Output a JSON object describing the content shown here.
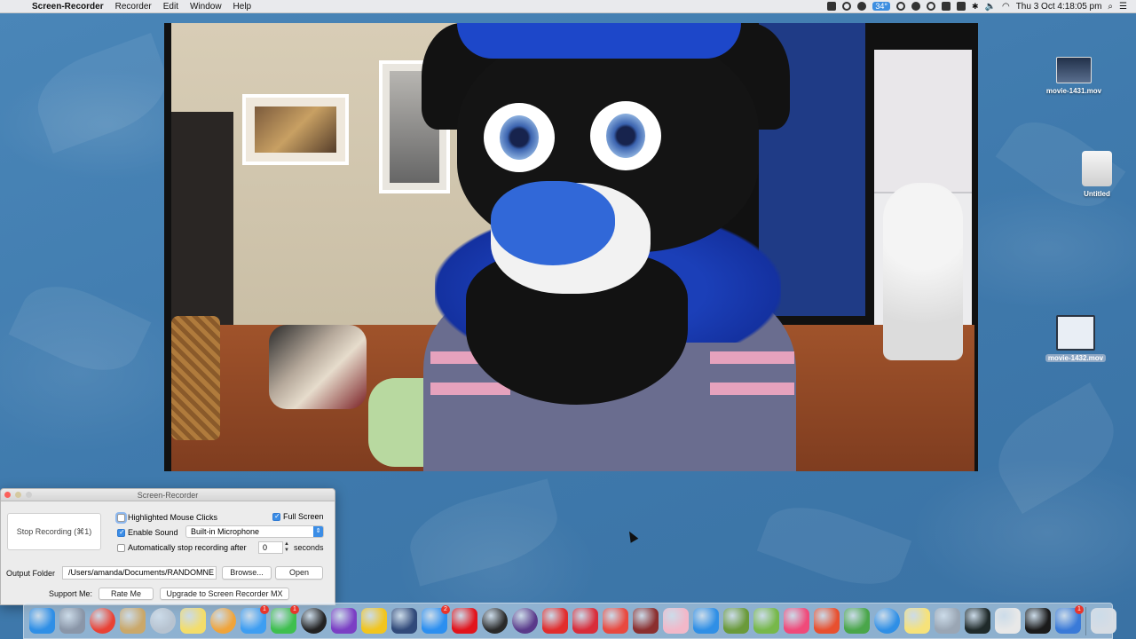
{
  "menubar": {
    "app_name": "Screen-Recorder",
    "menus": [
      "Recorder",
      "Edit",
      "Window",
      "Help"
    ],
    "temperature": "34°",
    "datetime": "Thu 3 Oct  4:18:05 pm"
  },
  "desktop_icons": [
    {
      "label": "movie-1431.mov",
      "icon": "video-file-icon"
    },
    {
      "label": "Untitled",
      "icon": "disk-drive-icon"
    },
    {
      "label": "movie-1432.mov",
      "icon": "video-file-icon",
      "selected": true
    }
  ],
  "recorder": {
    "title": "Screen-Recorder",
    "stop_button": "Stop Recording (⌘1)",
    "highlight_clicks": {
      "label": "Highlighted Mouse Clicks",
      "checked": false
    },
    "full_screen": {
      "label": "Full Screen",
      "checked": true
    },
    "enable_sound": {
      "label": "Enable Sound",
      "checked": true
    },
    "microphone": "Built-in Microphone",
    "auto_stop": {
      "label": "Automatically stop recording after",
      "checked": false,
      "value": "0",
      "unit": "seconds"
    },
    "output_folder_label": "Output Folder",
    "output_path": "/Users/amanda/Documents/RANDOMNE",
    "browse_button": "Browse...",
    "open_button": "Open",
    "support_label": "Support Me:",
    "rate_button": "Rate Me",
    "upgrade_button": "Upgrade to Screen Recorder MX"
  },
  "dock": {
    "apps": [
      {
        "name": "finder-icon",
        "color": "#2f8fe6"
      },
      {
        "name": "launchpad-icon",
        "color": "#8a96a8"
      },
      {
        "name": "chrome-icon",
        "color": "#e94235"
      },
      {
        "name": "paint-icon",
        "color": "#caa86a"
      },
      {
        "name": "help-icon",
        "color": "#b7c3d0"
      },
      {
        "name": "notes-icon",
        "color": "#f3dd6b"
      },
      {
        "name": "photos-icon",
        "color": "#f0a43a"
      },
      {
        "name": "messages-icon",
        "color": "#3e9ef2",
        "badge": "1"
      },
      {
        "name": "facetime-icon",
        "color": "#3fbf4f",
        "badge": "1"
      },
      {
        "name": "camera-icon",
        "color": "#222222"
      },
      {
        "name": "imovie-icon",
        "color": "#7b3fc4"
      },
      {
        "name": "sunflower-icon",
        "color": "#f2c51e"
      },
      {
        "name": "bluetooth-icon",
        "color": "#314a7a"
      },
      {
        "name": "app-store-icon",
        "color": "#2c8ff0",
        "badge": "2"
      },
      {
        "name": "heart-icon",
        "color": "#e2141c"
      },
      {
        "name": "obs-icon",
        "color": "#2a2a2a"
      },
      {
        "name": "record-icon",
        "color": "#5a3a8a"
      },
      {
        "name": "red-square-icon",
        "color": "#e12d2d"
      },
      {
        "name": "r-app-icon",
        "color": "#d92d3a"
      },
      {
        "name": "mail-icon",
        "color": "#e9493f"
      },
      {
        "name": "screen-recorder-icon",
        "color": "#8b2f2f"
      },
      {
        "name": "pink-app-icon",
        "color": "#f2b8c9"
      },
      {
        "name": "g-app-icon",
        "color": "#2f8fe6"
      },
      {
        "name": "minecraft-icon",
        "color": "#6a9a3a"
      },
      {
        "name": "layers-icon",
        "color": "#77b84a"
      },
      {
        "name": "music-icon",
        "color": "#f04a7a"
      },
      {
        "name": "triangle-icon",
        "color": "#e8502f"
      },
      {
        "name": "gem-icon",
        "color": "#4aa64a"
      },
      {
        "name": "safari-icon",
        "color": "#2f8fe6"
      },
      {
        "name": "stickies-icon",
        "color": "#f6e27a"
      },
      {
        "name": "shortcut-icon",
        "color": "#9aa6b4"
      },
      {
        "name": "activity-monitor-icon",
        "color": "#1f2a2a"
      },
      {
        "name": "textedit-icon",
        "color": "#e8e8e8"
      },
      {
        "name": "terminal-icon",
        "color": "#1b1b1b"
      },
      {
        "name": "xcode-icon",
        "color": "#3a7ad8",
        "badge": "1"
      },
      {
        "name": "trash-icon",
        "color": "#d7dde4"
      }
    ]
  }
}
